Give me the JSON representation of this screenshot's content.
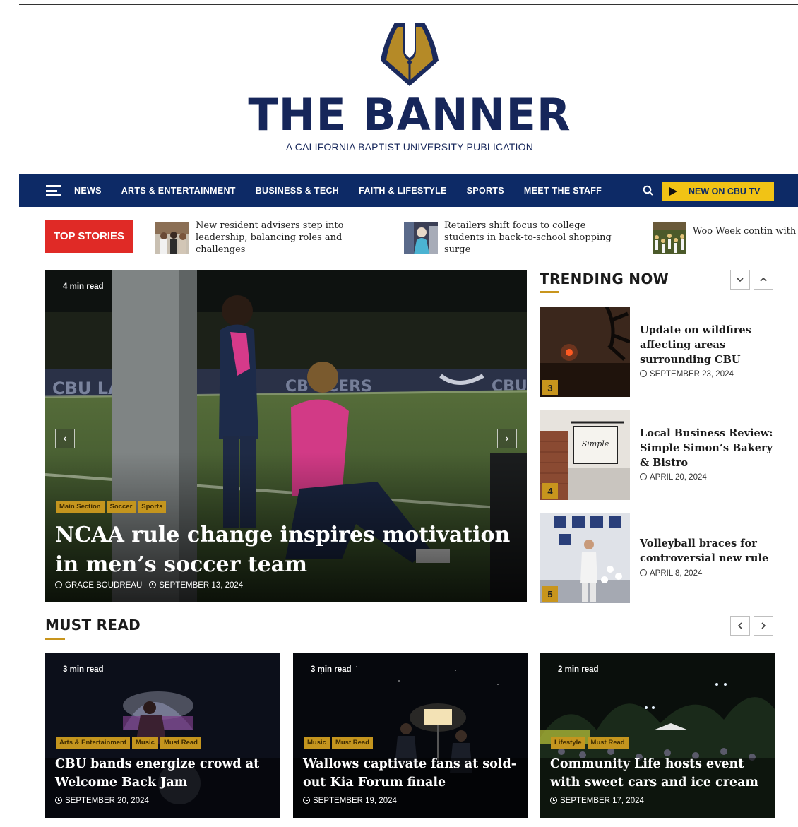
{
  "brand": {
    "title": "THE BANNER",
    "subtitle": "A CALIFORNIA BAPTIST UNIVERSITY PUBLICATION",
    "colors": {
      "navy": "#0d2a66",
      "gold": "#c8951d",
      "yellow": "#f1c315",
      "red": "#e02a26"
    }
  },
  "nav": {
    "links": [
      "NEWS",
      "ARTS & ENTERTAINMENT",
      "BUSINESS & TECH",
      "FAITH & LIFESTYLE",
      "SPORTS",
      "MEET THE STAFF"
    ],
    "cbu_tv_label": "NEW ON CBU TV"
  },
  "top_stories": {
    "badge": "TOP STORIES",
    "items": [
      {
        "title": "New resident advisers step into leadership, balancing roles and challenges"
      },
      {
        "title": "Retailers shift focus to college students in back-to-school shopping surge"
      },
      {
        "title": "Woo Week contin with highly antici"
      }
    ]
  },
  "hero": {
    "read_time": "4 min read",
    "tags": [
      "Main Section",
      "Soccer",
      "Sports"
    ],
    "title": "NCAA rule change inspires motivation in men’s soccer team",
    "author": "GRACE BOUDREAU",
    "date": "SEPTEMBER 13, 2024",
    "prev": "‹",
    "next": "›"
  },
  "trending": {
    "heading": "TRENDING NOW",
    "items": [
      {
        "rank": "3",
        "title": "Update on wildfires affecting areas surrounding CBU",
        "date": "SEPTEMBER 23, 2024"
      },
      {
        "rank": "4",
        "title": "Local Business Review: Simple Simon’s Bakery & Bistro",
        "date": "APRIL 20, 2024"
      },
      {
        "rank": "5",
        "title": "Volleyball braces for controversial new rule",
        "date": "APRIL 8, 2024"
      }
    ]
  },
  "must_read": {
    "heading": "MUST READ",
    "cards": [
      {
        "read_time": "3 min read",
        "tags": [
          "Arts & Entertainment",
          "Music",
          "Must Read"
        ],
        "title": "CBU bands energize crowd at Welcome Back Jam",
        "date": "SEPTEMBER 20, 2024"
      },
      {
        "read_time": "3 min read",
        "tags": [
          "Music",
          "Must Read"
        ],
        "title": "Wallows captivate fans at sold-out Kia Forum finale",
        "date": "SEPTEMBER 19, 2024"
      },
      {
        "read_time": "2 min read",
        "tags": [
          "Lifestyle",
          "Must Read"
        ],
        "title": "Community Life hosts event with sweet cars and ice cream",
        "date": "SEPTEMBER 17, 2024"
      }
    ]
  },
  "icons": [
    "menu-icon",
    "search-icon",
    "play-icon",
    "chevron-left-icon",
    "chevron-right-icon",
    "chevron-up-icon",
    "chevron-down-icon",
    "clock-icon",
    "person-icon"
  ]
}
